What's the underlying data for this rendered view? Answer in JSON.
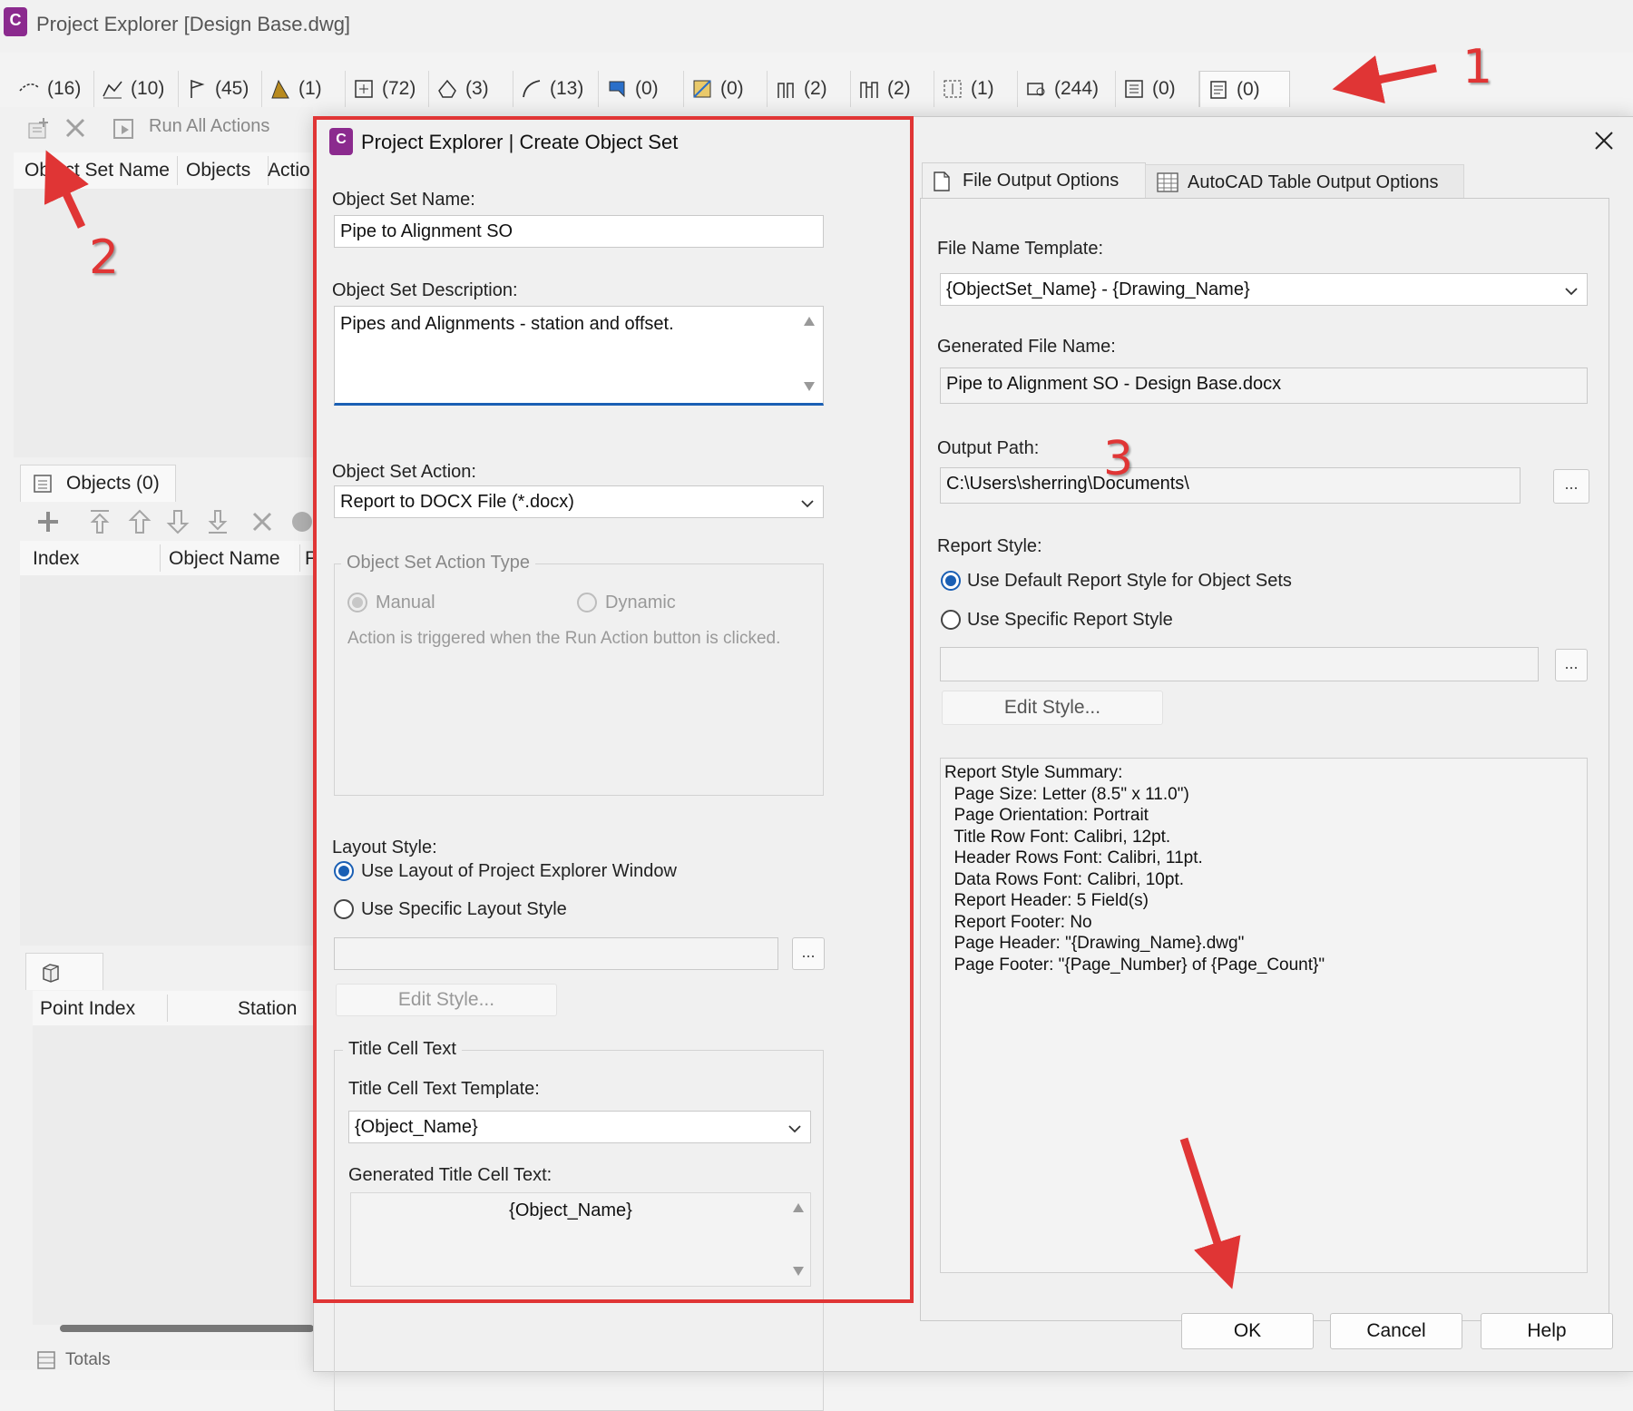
{
  "window": {
    "app_icon_letter": "C",
    "title": "Project Explorer [Design Base.dwg]"
  },
  "object_tabs": [
    {
      "icon": "alignment-icon",
      "count": "(16)"
    },
    {
      "icon": "profile-icon",
      "count": "(10)"
    },
    {
      "icon": "flag-icon",
      "count": "(45)"
    },
    {
      "icon": "surface-icon",
      "count": "(1)"
    },
    {
      "icon": "point-icon",
      "count": "(72)"
    },
    {
      "icon": "parcel-icon",
      "count": "(3)"
    },
    {
      "icon": "feature-line-icon",
      "count": "(13)"
    },
    {
      "icon": "corridor-icon",
      "count": "(0)"
    },
    {
      "icon": "assembly-icon",
      "count": "(0)"
    },
    {
      "icon": "pipe-network-icon",
      "count": "(2)"
    },
    {
      "icon": "pressure-network-icon",
      "count": "(2)"
    },
    {
      "icon": "sample-line-icon",
      "count": "(1)"
    },
    {
      "icon": "view-frame-icon",
      "count": "(244)"
    },
    {
      "icon": "list-icon",
      "count": "(0)"
    },
    {
      "icon": "object-set-icon",
      "count": "(0)"
    }
  ],
  "left_panel": {
    "toolbar": {
      "run_all_label": "Run All Actions"
    },
    "columns": [
      "Object Set Name",
      "Objects",
      "Actio"
    ],
    "objects_tab_label": "Objects (0)",
    "objects_columns": [
      "Index",
      "Object Name",
      "F"
    ],
    "points_columns": [
      "Point Index",
      "Station"
    ],
    "totals_label": "Totals"
  },
  "dialog": {
    "icon_letter": "C",
    "title": "Project Explorer | Create Object Set",
    "object_set_name_label": "Object Set Name:",
    "object_set_name_value": "Pipe to Alignment SO",
    "description_label": "Object Set Description:",
    "description_value": "Pipes and Alignments - station and offset.",
    "action_label": "Object Set Action:",
    "action_value": "Report to DOCX File (*.docx)",
    "action_type": {
      "title": "Object Set Action Type",
      "manual": "Manual",
      "dynamic": "Dynamic",
      "note": "Action is triggered when the Run Action button is clicked."
    },
    "layout_style": {
      "label": "Layout Style:",
      "option1": "Use Layout of Project Explorer Window",
      "option2": "Use Specific Layout Style",
      "edit_style": "Edit Style..."
    },
    "title_cell": {
      "group_title": "Title Cell Text",
      "template_label": "Title Cell Text Template:",
      "template_value": "{Object_Name}",
      "generated_label": "Generated Title Cell Text:",
      "generated_value": "{Object_Name}"
    },
    "right_tabs": [
      "File Output Options",
      "AutoCAD Table Output Options"
    ],
    "file_name_template_label": "File Name Template:",
    "file_name_template_value": "{ObjectSet_Name} - {Drawing_Name}",
    "generated_file_name_label": "Generated File Name:",
    "generated_file_name_value": "Pipe to Alignment SO - Design Base.docx",
    "output_path_label": "Output Path:",
    "output_path_value": "C:\\Users\\sherring\\Documents\\",
    "report_style": {
      "label": "Report Style:",
      "option1": "Use Default Report Style for Object Sets",
      "option2": "Use Specific Report Style",
      "edit_style": "Edit Style..."
    },
    "summary_lines": [
      "Report Style Summary:",
      "  Page Size: Letter (8.5\" x 11.0\")",
      "  Page Orientation: Portrait",
      "  Title Row Font: Calibri, 12pt.",
      "  Header Rows Font: Calibri, 11pt.",
      "  Data Rows Font: Calibri, 10pt.",
      "  Report Header: 5 Field(s)",
      "  Report Footer: No",
      "  Page Header: \"{Drawing_Name}.dwg\"",
      "  Page Footer: \"{Page_Number} of {Page_Count}\""
    ],
    "buttons": {
      "ok": "OK",
      "cancel": "Cancel",
      "help": "Help"
    },
    "ellipsis": "..."
  },
  "annotations": {
    "n1": "1",
    "n2": "2",
    "n3": "3",
    "color": "#e03535"
  }
}
